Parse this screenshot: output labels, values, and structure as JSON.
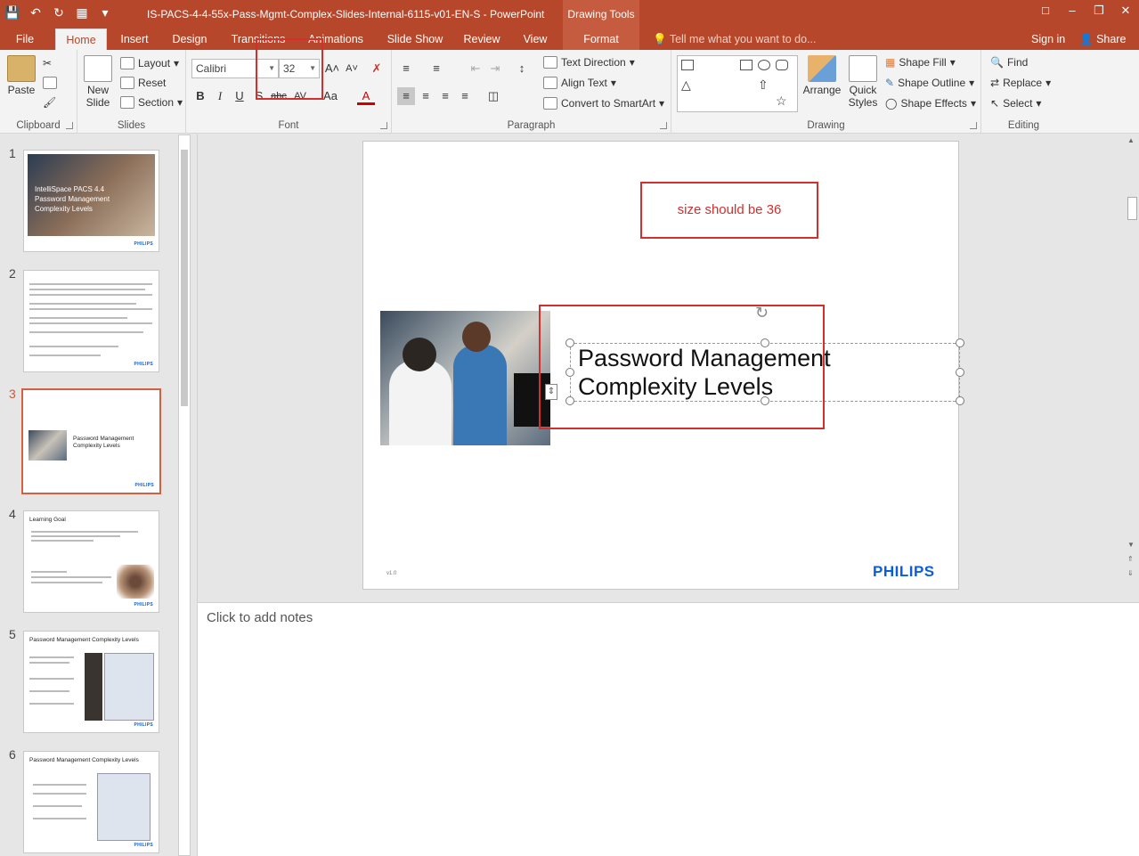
{
  "window": {
    "title": "IS-PACS-4-4-55x-Pass-Mgmt-Complex-Slides-Internal-6115-v01-EN-S - PowerPoint",
    "contextual_tab_group": "Drawing Tools",
    "accent": "#b7472a"
  },
  "tabs": [
    "File",
    "Home",
    "Insert",
    "Design",
    "Transitions",
    "Animations",
    "Slide Show",
    "Review",
    "View",
    "Format"
  ],
  "active_tab": "Home",
  "tell_me": "Tell me what you want to do...",
  "sign_in": "Sign in",
  "share": "Share",
  "ribbon": {
    "clipboard": {
      "label": "Clipboard",
      "paste": "Paste"
    },
    "slides": {
      "label": "Slides",
      "new_slide": "New Slide",
      "layout": "Layout",
      "reset": "Reset",
      "section": "Section"
    },
    "font": {
      "label": "Font",
      "name": "Calibri",
      "size": "32"
    },
    "paragraph": {
      "label": "Paragraph",
      "text_direction": "Text Direction",
      "align_text": "Align Text",
      "convert_smartart": "Convert to SmartArt"
    },
    "drawing": {
      "label": "Drawing",
      "arrange": "Arrange",
      "quick_styles": "Quick Styles",
      "shape_fill": "Shape Fill",
      "shape_outline": "Shape Outline",
      "shape_effects": "Shape Effects"
    },
    "editing": {
      "label": "Editing",
      "find": "Find",
      "replace": "Replace",
      "select": "Select"
    }
  },
  "thumbnails": [
    {
      "num": "1",
      "title": "IntelliSpace PACS 4.4 Password Management Complexity Levels"
    },
    {
      "num": "2",
      "title": ""
    },
    {
      "num": "3",
      "title": "Password Management Complexity Levels"
    },
    {
      "num": "4",
      "title": "Learning Goal"
    },
    {
      "num": "5",
      "title": "Password Management Complexity Levels"
    },
    {
      "num": "6",
      "title": "Password Management Complexity Levels"
    }
  ],
  "active_slide": 3,
  "slide": {
    "title_line1": "Password Management",
    "title_line2": "Complexity Levels",
    "version": "v1.0",
    "logo": "PHILIPS"
  },
  "annotation": "size should be 36",
  "notes_placeholder": "Click to add notes"
}
